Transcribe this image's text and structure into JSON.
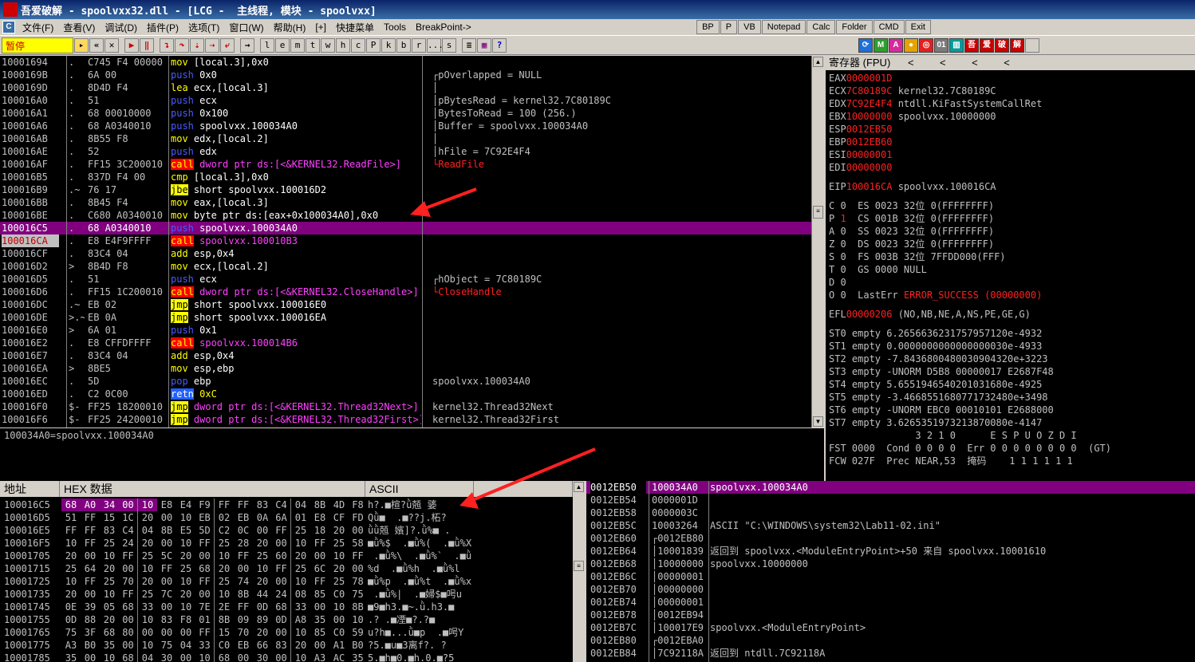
{
  "window": {
    "title": "吾爱破解 - spoolvxx32.dll - [LCG -  主线程, 模块 - spoolvxx]",
    "logo_text": "吾爱破解"
  },
  "menu": {
    "items": [
      "文件(F)",
      "查看(V)",
      "调试(D)",
      "插件(P)",
      "选项(T)",
      "窗口(W)",
      "帮助(H)",
      "[+]",
      "快捷菜单",
      "Tools",
      "BreakPoint->"
    ],
    "buttons": [
      "BP",
      "P",
      "VB",
      "Notepad",
      "Calc",
      "Folder",
      "CMD",
      "Exit"
    ]
  },
  "toolbar": {
    "status": "暂停",
    "letters": [
      "l",
      "e",
      "m",
      "t",
      "w",
      "h",
      "c",
      "P",
      "k",
      "b",
      "r",
      "...",
      "s"
    ]
  },
  "colors": {
    "background": "#000000",
    "text": "#c0c0c0",
    "highlight": "#800080",
    "register_changed": "#ff2020",
    "call_bg": "#ff0000",
    "jmp_bg": "#ffff00",
    "push_color": "#4040ff"
  },
  "cpu": {
    "rows": [
      {
        "addr": "10001694",
        "mark": ".",
        "hex": "C745 F4 00000",
        "dis": "mov [local.3],0x0",
        "kind": "mov",
        "com": ""
      },
      {
        "addr": "1000169B",
        "mark": ".",
        "hex": "6A 00",
        "dis": "push 0x0",
        "kind": "push",
        "com": "┌pOverlapped = NULL"
      },
      {
        "addr": "1000169D",
        "mark": ".",
        "hex": "8D4D F4",
        "dis": "lea ecx,[local.3]",
        "kind": "mov",
        "com": "│"
      },
      {
        "addr": "100016A0",
        "mark": ".",
        "hex": "51",
        "dis": "push ecx",
        "kind": "push",
        "com": "│pBytesRead = kernel32.7C80189C"
      },
      {
        "addr": "100016A1",
        "mark": ".",
        "hex": "68 00010000",
        "dis": "push 0x100",
        "kind": "push",
        "com": "│BytesToRead = 100 (256.)"
      },
      {
        "addr": "100016A6",
        "mark": ".",
        "hex": "68 A0340010",
        "dis": "push spoolvxx.100034A0",
        "kind": "push",
        "com": "│Buffer = spoolvxx.100034A0"
      },
      {
        "addr": "100016AB",
        "mark": ".",
        "hex": "8B55 F8",
        "dis": "mov edx,[local.2]",
        "kind": "mov",
        "com": "│"
      },
      {
        "addr": "100016AE",
        "mark": ".",
        "hex": "52",
        "dis": "push edx",
        "kind": "push",
        "com": "│hFile = 7C92E4F4"
      },
      {
        "addr": "100016AF",
        "mark": ".",
        "hex": "FF15 3C200010",
        "dis": "call dword ptr ds:[<&KERNEL32.ReadFile>]",
        "kind": "call",
        "com": "└ReadFile"
      },
      {
        "addr": "100016B5",
        "mark": ".",
        "hex": "837D F4 00",
        "dis": "cmp [local.3],0x0",
        "kind": "mov",
        "com": ""
      },
      {
        "addr": "100016B9",
        "mark": ".~",
        "hex": "76 17",
        "dis": "jbe short spoolvxx.100016D2",
        "kind": "jmp",
        "com": ""
      },
      {
        "addr": "100016BB",
        "mark": ".",
        "hex": "8B45 F4",
        "dis": "mov eax,[local.3]",
        "kind": "mov",
        "com": ""
      },
      {
        "addr": "100016BE",
        "mark": ".",
        "hex": "C680 A0340010",
        "dis": "mov byte ptr ds:[eax+0x100034A0],0x0",
        "kind": "mov",
        "com": ""
      },
      {
        "addr": "100016C5",
        "mark": ".",
        "hex": "68 A0340010",
        "dis": "push spoolvxx.100034A0",
        "kind": "push",
        "com": "",
        "cur": true
      },
      {
        "addr": "100016CA",
        "mark": ".",
        "hex": "E8 E4F9FFFF",
        "dis": "call spoolvxx.100010B3",
        "kind": "call",
        "com": "",
        "eip": true
      },
      {
        "addr": "100016CF",
        "mark": ".",
        "hex": "83C4 04",
        "dis": "add esp,0x4",
        "kind": "mov",
        "com": ""
      },
      {
        "addr": "100016D2",
        "mark": ">",
        "hex": "8B4D F8",
        "dis": "mov ecx,[local.2]",
        "kind": "mov",
        "com": ""
      },
      {
        "addr": "100016D5",
        "mark": ".",
        "hex": "51",
        "dis": "push ecx",
        "kind": "push",
        "com": "┌hObject = 7C80189C"
      },
      {
        "addr": "100016D6",
        "mark": ".",
        "hex": "FF15 1C200010",
        "dis": "call dword ptr ds:[<&KERNEL32.CloseHandle>]",
        "kind": "call",
        "com": "└CloseHandle"
      },
      {
        "addr": "100016DC",
        "mark": ".~",
        "hex": "EB 02",
        "dis": "jmp short spoolvxx.100016E0",
        "kind": "jmp",
        "com": ""
      },
      {
        "addr": "100016DE",
        "mark": ">.~",
        "hex": "EB 0A",
        "dis": "jmp short spoolvxx.100016EA",
        "kind": "jmp",
        "com": ""
      },
      {
        "addr": "100016E0",
        "mark": ">",
        "hex": "6A 01",
        "dis": "push 0x1",
        "kind": "push",
        "com": ""
      },
      {
        "addr": "100016E2",
        "mark": ".",
        "hex": "E8 CFFDFFFF",
        "dis": "call spoolvxx.100014B6",
        "kind": "call",
        "com": ""
      },
      {
        "addr": "100016E7",
        "mark": ".",
        "hex": "83C4 04",
        "dis": "add esp,0x4",
        "kind": "mov",
        "com": ""
      },
      {
        "addr": "100016EA",
        "mark": ">",
        "hex": "8BE5",
        "dis": "mov esp,ebp",
        "kind": "mov",
        "com": ""
      },
      {
        "addr": "100016EC",
        "mark": ".",
        "hex": "5D",
        "dis": "pop ebp",
        "kind": "push",
        "com": "spoolvxx.100034A0"
      },
      {
        "addr": "100016ED",
        "mark": ".",
        "hex": "C2 0C00",
        "dis": "retn 0xC",
        "kind": "ret",
        "com": ""
      },
      {
        "addr": "100016F0",
        "mark": "$-",
        "hex": "FF25 18200010",
        "dis": "jmp dword ptr ds:[<&KERNEL32.Thread32Next>]",
        "kind": "jmp",
        "com": "kernel32.Thread32Next"
      },
      {
        "addr": "100016F6",
        "mark": "$-",
        "hex": "FF25 24200010",
        "dis": "jmp dword ptr ds:[<&KERNEL32.Thread32First>]",
        "kind": "jmp",
        "com": "kernel32.Thread32First"
      }
    ]
  },
  "info_line": "100034A0=spoolvxx.100034A0",
  "registers": {
    "header": "寄存器 (FPU)",
    "header_arrows": "<         <         <         <",
    "gp": [
      {
        "name": "EAX",
        "val": "0000001D",
        "note": ""
      },
      {
        "name": "ECX",
        "val": "7C80189C",
        "note": "kernel32.7C80189C"
      },
      {
        "name": "EDX",
        "val": "7C92E4F4",
        "note": "ntdll.KiFastSystemCallRet"
      },
      {
        "name": "EBX",
        "val": "10000000",
        "note": "spoolvxx.10000000"
      },
      {
        "name": "ESP",
        "val": "0012EB50",
        "note": ""
      },
      {
        "name": "EBP",
        "val": "0012EB60",
        "note": ""
      },
      {
        "name": "ESI",
        "val": "00000001",
        "note": ""
      },
      {
        "name": "EDI",
        "val": "00000000",
        "note": ""
      }
    ],
    "eip": {
      "name": "EIP",
      "val": "100016CA",
      "note": "spoolvxx.100016CA"
    },
    "flags": [
      {
        "f": "C 0",
        "seg": "ES 0023 32位 0(FFFFFFFF)"
      },
      {
        "f": "P 1",
        "seg": "CS 001B 32位 0(FFFFFFFF)"
      },
      {
        "f": "A 0",
        "seg": "SS 0023 32位 0(FFFFFFFF)"
      },
      {
        "f": "Z 0",
        "seg": "DS 0023 32位 0(FFFFFFFF)"
      },
      {
        "f": "S 0",
        "seg": "FS 003B 32位 7FFDD000(FFF)"
      },
      {
        "f": "T 0",
        "seg": "GS 0000 NULL"
      },
      {
        "f": "D 0",
        "seg": ""
      },
      {
        "f": "O 0",
        "seg": "LastErr ERROR_SUCCESS (00000000)"
      }
    ],
    "efl": {
      "name": "EFL",
      "val": "00000206",
      "note": "(NO,NB,NE,A,NS,PE,GE,G)"
    },
    "fpu": [
      "ST0 empty 6.2656636231757957120e-4932",
      "ST1 empty 0.0000000000000000030e-4933",
      "ST2 empty -7.8436800480030904320e+3223",
      "ST3 empty -UNORM D5B8 00000017 E2687F48",
      "ST4 empty 5.6551946540201031680e-4925",
      "ST5 empty -3.4668551680771732480e+3498",
      "ST6 empty -UNORM EBC0 00010101 E2688000",
      "ST7 empty 3.6265351973213870080e-4147"
    ],
    "fpu_bits_header": "               3 2 1 0      E S P U O Z D I",
    "fst": "FST 0000  Cond 0 0 0 0  Err 0 0 0 0 0 0 0 0  (GT)",
    "fcw": "FCW 027F  Prec NEAR,53  掩码    1 1 1 1 1 1"
  },
  "dump": {
    "headers": {
      "addr": "地址",
      "hex": "HEX 数据",
      "ascii": "ASCII"
    },
    "rows": [
      {
        "addr": "100016C5",
        "hex": [
          "68",
          "A0",
          "34",
          "00",
          "10",
          "E8",
          "E4",
          "F9",
          "FF",
          "FF",
          "83",
          "C4",
          "04",
          "8B",
          "4D",
          "F8"
        ],
        "sel": 5,
        "ascii": "h?.■楦?ǜ兡 婱"
      },
      {
        "addr": "100016D5",
        "hex": [
          "51",
          "FF",
          "15",
          "1C",
          "20",
          "00",
          "10",
          "EB",
          "02",
          "EB",
          "0A",
          "6A",
          "01",
          "E8",
          "CF",
          "FD"
        ],
        "sel": 0,
        "ascii": "Qǜ■  .■??j.柘?"
      },
      {
        "addr": "100016E5",
        "hex": [
          "FF",
          "FF",
          "83",
          "C4",
          "04",
          "8B",
          "E5",
          "5D",
          "C2",
          "0C",
          "00",
          "FF",
          "25",
          "18",
          "20",
          "00"
        ],
        "sel": 0,
        "ascii": "ǜǜ兡 嬪]?.ǜ%■ ."
      },
      {
        "addr": "100016F5",
        "hex": [
          "10",
          "FF",
          "25",
          "24",
          "20",
          "00",
          "10",
          "FF",
          "25",
          "28",
          "20",
          "00",
          "10",
          "FF",
          "25",
          "58"
        ],
        "sel": 0,
        "ascii": "■ǜ%$  .■ǜ%(  .■ǜ%X"
      },
      {
        "addr": "10001705",
        "hex": [
          "20",
          "00",
          "10",
          "FF",
          "25",
          "5C",
          "20",
          "00",
          "10",
          "FF",
          "25",
          "60",
          "20",
          "00",
          "10",
          "FF"
        ],
        "sel": 0,
        "ascii": " .■ǜ%\\  .■ǜ%`  .■ǜ"
      },
      {
        "addr": "10001715",
        "hex": [
          "25",
          "64",
          "20",
          "00",
          "10",
          "FF",
          "25",
          "68",
          "20",
          "00",
          "10",
          "FF",
          "25",
          "6C",
          "20",
          "00"
        ],
        "sel": 0,
        "ascii": "%d  .■ǜ%h  .■ǜ%l  ."
      },
      {
        "addr": "10001725",
        "hex": [
          "10",
          "FF",
          "25",
          "70",
          "20",
          "00",
          "10",
          "FF",
          "25",
          "74",
          "20",
          "00",
          "10",
          "FF",
          "25",
          "78"
        ],
        "sel": 0,
        "ascii": "■ǜ%p  .■ǜ%t  .■ǜ%x"
      },
      {
        "addr": "10001735",
        "hex": [
          "20",
          "00",
          "10",
          "FF",
          "25",
          "7C",
          "20",
          "00",
          "10",
          "8B",
          "44",
          "24",
          "08",
          "85",
          "C0",
          "75"
        ],
        "sel": 0,
        "ascii": " .■ǜ%|  .■婦$■呺u"
      },
      {
        "addr": "10001745",
        "hex": [
          "0E",
          "39",
          "05",
          "68",
          "33",
          "00",
          "10",
          "7E",
          "2E",
          "FF",
          "0D",
          "68",
          "33",
          "00",
          "10",
          "8B"
        ],
        "sel": 0,
        "ascii": "■9■h3.■~.ǜ.h3.■"
      },
      {
        "addr": "10001755",
        "hex": [
          "0D",
          "88",
          "20",
          "00",
          "10",
          "83",
          "F8",
          "01",
          "8B",
          "09",
          "89",
          "0D",
          "A8",
          "35",
          "00",
          "10"
        ],
        "sel": 0,
        "ascii": ".? .■凐■?.?■"
      },
      {
        "addr": "10001765",
        "hex": [
          "75",
          "3F",
          "68",
          "80",
          "00",
          "00",
          "00",
          "FF",
          "15",
          "70",
          "20",
          "00",
          "10",
          "85",
          "C0",
          "59"
        ],
        "sel": 0,
        "ascii": "u?h■...ǜ■p  .■呺Y"
      },
      {
        "addr": "10001775",
        "hex": [
          "A3",
          "B0",
          "35",
          "00",
          "10",
          "75",
          "04",
          "33",
          "C0",
          "EB",
          "66",
          "83",
          "20",
          "00",
          "A1",
          "B0"
        ],
        "sel": 0,
        "ascii": "?5.■u■3离f?. ?"
      },
      {
        "addr": "10001785",
        "hex": [
          "35",
          "00",
          "10",
          "68",
          "04",
          "30",
          "00",
          "10",
          "68",
          "00",
          "30",
          "00",
          "10",
          "A3",
          "AC",
          "35"
        ],
        "sel": 0,
        "ascii": "5.■h■0.■h.0.■?5"
      }
    ]
  },
  "stack": {
    "rows": [
      {
        "addr": "0012EB50",
        "val": "100034A0",
        "com": "spoolvxx.100034A0",
        "cur": true
      },
      {
        "addr": "0012EB54",
        "val": "0000001D",
        "com": ""
      },
      {
        "addr": "0012EB58",
        "val": "0000003C",
        "com": ""
      },
      {
        "addr": "0012EB5C",
        "val": "10003264",
        "com": "ASCII \"C:\\WINDOWS\\system32\\Lab11-02.ini\""
      },
      {
        "addr": "0012EB60",
        "val": "┌0012EB80",
        "com": ""
      },
      {
        "addr": "0012EB64",
        "val": "│10001839",
        "com": "返回到 spoolvxx.<ModuleEntryPoint>+50 来自 spoolvxx.10001610"
      },
      {
        "addr": "0012EB68",
        "val": "│10000000",
        "com": "spoolvxx.10000000"
      },
      {
        "addr": "0012EB6C",
        "val": "│00000001",
        "com": ""
      },
      {
        "addr": "0012EB70",
        "val": "│00000000",
        "com": ""
      },
      {
        "addr": "0012EB74",
        "val": "│00000001",
        "com": ""
      },
      {
        "addr": "0012EB78",
        "val": "│0012EB94",
        "com": ""
      },
      {
        "addr": "0012EB7C",
        "val": "│100017E9",
        "com": "spoolvxx.<ModuleEntryPoint>"
      },
      {
        "addr": "0012EB80",
        "val": "┌0012EBA0",
        "com": ""
      },
      {
        "addr": "0012EB84",
        "val": "│7C92118A",
        "com": "返回到 ntdll.7C92118A"
      }
    ]
  }
}
